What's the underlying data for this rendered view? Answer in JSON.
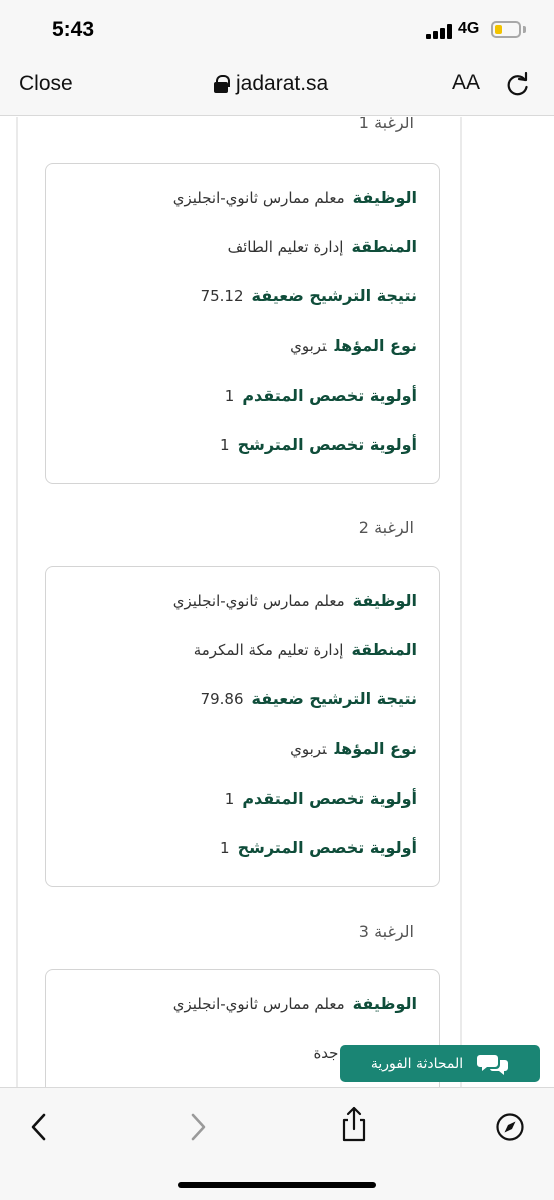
{
  "status_bar": {
    "time": "5:43",
    "network": "4G",
    "battery_level": 0.3
  },
  "browser": {
    "close_label": "Close",
    "url": "jadarat.sa",
    "text_size_label": "AA",
    "icons": {
      "lock": "lock-icon",
      "reload": "reload-icon"
    }
  },
  "choices": [
    {
      "label": "الرغبة 1",
      "fields": [
        {
          "key": "الوظيفة",
          "value": "معلم ممارس ثانوي-انجليزي"
        },
        {
          "key": "المنطقة",
          "value": "إدارة تعليم الطائف"
        },
        {
          "key": "نتيجة الترشيح ضعيفة",
          "value": "75.12"
        },
        {
          "key": "نوع المؤهل",
          "value": "تربوي"
        },
        {
          "key": "أولوية تخصص المتقدم",
          "value": "1"
        },
        {
          "key": "أولوية تخصص المترشح",
          "value": "1"
        }
      ]
    },
    {
      "label": "الرغبة 2",
      "fields": [
        {
          "key": "الوظيفة",
          "value": "معلم ممارس ثانوي-انجليزي"
        },
        {
          "key": "المنطقة",
          "value": "إدارة تعليم مكة المكرمة"
        },
        {
          "key": "نتيجة الترشيح ضعيفة",
          "value": "79.86"
        },
        {
          "key": "نوع المؤهل",
          "value": "تربوي"
        },
        {
          "key": "أولوية تخصص المتقدم",
          "value": "1"
        },
        {
          "key": "أولوية تخصص المترشح",
          "value": "1"
        }
      ]
    },
    {
      "label": "الرغبة 3",
      "fields": [
        {
          "key": "الوظيفة",
          "value": "معلم ممارس ثانوي-انجليزي"
        },
        {
          "key": "",
          "value": "إدارة تعليم جدة"
        }
      ]
    }
  ],
  "chat": {
    "label": "المحادثة الفورية",
    "icon": "chat-bubbles-icon"
  },
  "toolbar": {
    "icons": [
      "back-icon",
      "forward-icon",
      "share-icon",
      "compass-icon"
    ]
  },
  "colors": {
    "accent": "#1a8574",
    "key_text": "#0f4d3a",
    "battery": "#f2c300"
  }
}
